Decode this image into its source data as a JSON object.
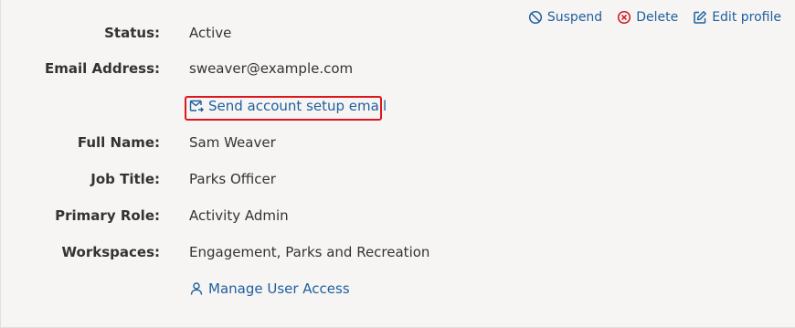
{
  "actions": {
    "suspend": "Suspend",
    "delete": "Delete",
    "edit": "Edit profile"
  },
  "fields": {
    "status": {
      "label": "Status:",
      "value": "Active"
    },
    "email": {
      "label": "Email Address:",
      "value": "sweaver@example.com"
    },
    "full_name": {
      "label": "Full Name:",
      "value": "Sam Weaver"
    },
    "job_title": {
      "label": "Job Title:",
      "value": "Parks Officer"
    },
    "primary_role": {
      "label": "Primary Role:",
      "value": "Activity Admin"
    },
    "workspaces": {
      "label": "Workspaces:",
      "value": "Engagement, Parks and Recreation"
    }
  },
  "links": {
    "send_setup_email": "Send account setup email",
    "manage_access": "Manage User Access"
  },
  "colors": {
    "link": "#1f5f9e",
    "danger": "#d0141c",
    "highlight": "#e0141c",
    "background": "#f6f5f4"
  },
  "icons": {
    "suspend": "ban-icon",
    "delete": "x-circle-icon",
    "edit": "edit-icon",
    "send_email": "mail-send-icon",
    "manage_access": "user-icon"
  }
}
